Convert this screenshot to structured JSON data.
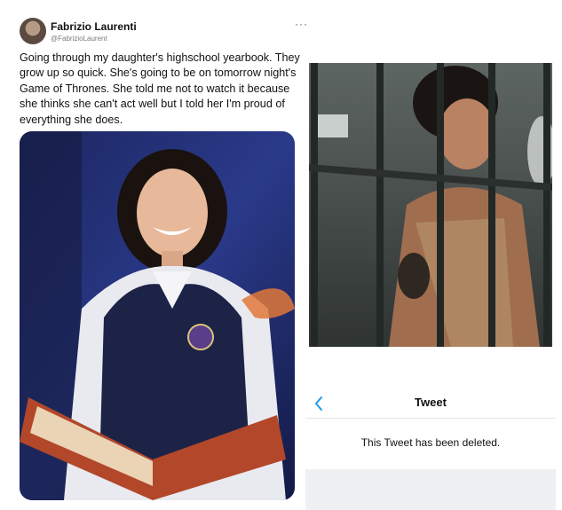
{
  "tweet": {
    "author_name": "Fabrizio Laurenti",
    "author_handle": "@FabrizioLaurent",
    "more_icon": "ellipsis-icon",
    "text": "Going through my daughter's highschool yearbook. They grow up so quick. She's going to be on tomorrow night's Game of Thrones. She told me not to watch it because she thinks she can't act well but I told her I'm proud of everything she does."
  },
  "deleted_view": {
    "back_icon": "chevron-left-icon",
    "title": "Tweet",
    "message": "This Tweet has been deleted.",
    "accent_color": "#1d9bf0"
  }
}
